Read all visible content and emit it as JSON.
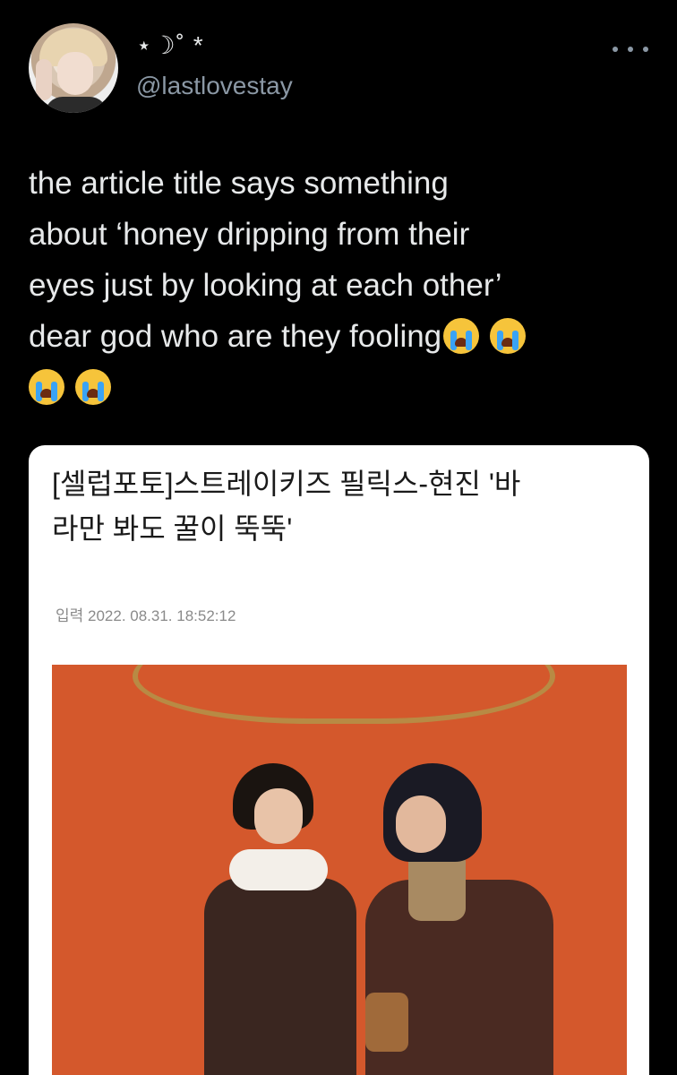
{
  "user": {
    "display_name": "⋆☽˚ *",
    "handle": "@lastlovestay"
  },
  "tweet": {
    "lines": [
      "the article title says something",
      "about ‘honey dripping from their",
      "eyes just by looking at each other’",
      "dear god who are they fooling"
    ],
    "emoji_name": "loudly-crying-face"
  },
  "article": {
    "title_lines": [
      "[셀럽포토]스트레이키즈 필릭스-현진 '바",
      "라만 봐도 꿀이 뚝뚝'"
    ],
    "meta": "입력 2022. 08.31. 18:52:12"
  },
  "colors": {
    "background": "#000000",
    "text": "#e7e9ea",
    "secondary": "#8b98a5",
    "card": "#ffffff",
    "photo_background": "#d4582c"
  }
}
